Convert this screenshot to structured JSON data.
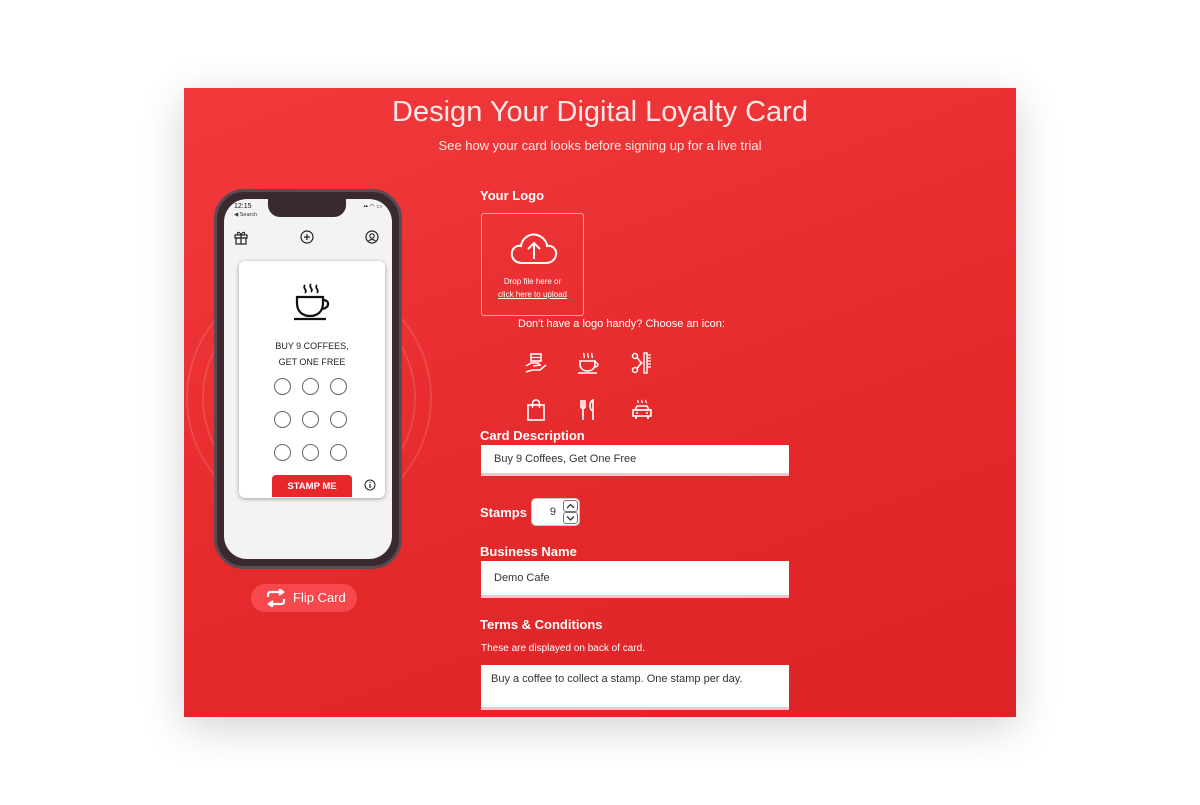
{
  "header": {
    "title": "Design Your Digital Loyalty Card",
    "subtitle": "See how your card looks before signing up for a live trial"
  },
  "phone": {
    "status_time": "12:15",
    "status_back": "◀ Search",
    "status_icons": "▪▪ ◠ ▭",
    "card_offer_line1": "BUY 9 COFFEES,",
    "card_offer_line2": "GET ONE FREE",
    "stamp_count": 9,
    "stamp_button": "STAMP ME"
  },
  "flip_button": "Flip Card",
  "form": {
    "logo_label": "Your Logo",
    "upload_drop_text": "Drop file here or",
    "upload_link_text": "click here to upload",
    "choose_icon_text": "Don't have a logo handy? Choose an icon:",
    "icons": [
      "delivery-icon",
      "coffee-icon",
      "barber-icon",
      "shopping-bag-icon",
      "cutlery-icon",
      "car-wash-icon"
    ],
    "description_label": "Card Description",
    "description_value": "Buy 9 Coffees, Get One Free",
    "stamps_label": "Stamps",
    "stamps_value": "9",
    "business_label": "Business Name",
    "business_value": "Demo Cafe",
    "terms_label": "Terms & Conditions",
    "terms_note": "These are displayed on back of card.",
    "terms_value": "Buy a coffee to collect a stamp. One stamp per day."
  },
  "colors": {
    "panel": "#e52a2c",
    "stamp_button": "#e8262b",
    "flip_button": "#f7484d"
  }
}
